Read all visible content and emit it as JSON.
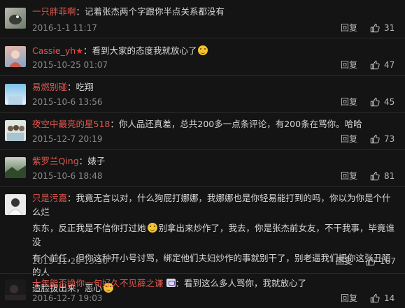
{
  "reply_label": "回复",
  "colors": {
    "username": "#e0574f",
    "background": "#141414"
  },
  "comments": [
    {
      "username": "一只胖菲啊",
      "sep": "：",
      "text": "记着张杰两个字跟你半点关系都没有",
      "date": "2016-1-1 11:17",
      "likes": "31",
      "avatar": "avatar-bird"
    },
    {
      "username": "Cassie_yh",
      "sep": "：",
      "text": "看到大家的态度我就放心了",
      "date": "2015-10-25 01:07",
      "likes": "47",
      "avatar": "avatar-illustration"
    },
    {
      "username": "易燃别碰",
      "sep": "：",
      "text": "吃翔",
      "date": "2015-10-6 13:56",
      "likes": "45",
      "avatar": "avatar-sky"
    },
    {
      "username": "夜空中最亮的星518",
      "sep": "：",
      "text": "你人品还真差，总共200多一点条评论，有200条在骂你。哈哈",
      "date": "2015-12-7 20:19",
      "likes": "73",
      "avatar": "avatar-group"
    },
    {
      "username": "紫罗兰Qing",
      "sep": "：",
      "text": "婊子",
      "date": "2015-10-6 18:48",
      "likes": "81",
      "avatar": "avatar-landscape"
    },
    {
      "username": "只是污嘉",
      "sep": "：",
      "text_line1": "我竟无言以对，什么狗屁打娜娜，我娜娜也是你轻易能打到的吗，你以为你是个什么烂",
      "text_line2a": "东东，反正我是不信你打过她",
      "text_line2b": "别拿出来炒作了，我去，你是张杰前女友，不干我事，毕竟谁没",
      "text_line3": "有个前任，但你这种开小号讨骂，绑定他们夫妇炒作的事就别干了，别老逼我们把你这张丑陋的人",
      "text_line4": "造脸拔出来，恶心",
      "date": "2015-11-20 13:30",
      "likes": "167",
      "avatar": "avatar-girl"
    },
    {
      "username": "十年能否换你一句好久不见薛之谦",
      "sep": "：",
      "text": "看到这么多人骂你，我就放心了",
      "date": "2016-12-7 19:03",
      "likes": "14",
      "avatar": "avatar-dark"
    }
  ]
}
